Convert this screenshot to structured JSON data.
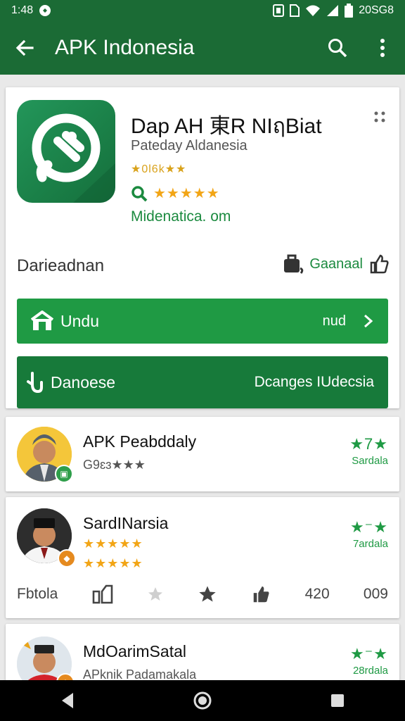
{
  "status_bar": {
    "time": "1:48",
    "right_text": "20SG8",
    "icons": [
      "circle-notification-icon",
      "nfc-icon",
      "sim-icon",
      "wifi-icon",
      "signal-icon",
      "battery-icon"
    ]
  },
  "app_bar": {
    "title": "APK Indonesia",
    "background": "#1b6b35",
    "icons": [
      "back-arrow-icon",
      "search-icon",
      "more-vert-icon"
    ]
  },
  "app": {
    "name": "Dap AH 東R NIฤBiat",
    "developer": "Pateday Aldanesia",
    "rating_small": "★0l6k★★",
    "rating_stars": "★★★★★",
    "link": "Midenatica. om"
  },
  "description": {
    "label": "Darieadnan",
    "right_label": "Gaanaal"
  },
  "primary_button": {
    "label": "Undu",
    "meta": "nud",
    "color": "#1f9a44"
  },
  "secondary_button": {
    "label": "Danoese",
    "meta": "Dcanges IUdecsia",
    "color": "#177a3a"
  },
  "reviews": [
    {
      "name": "APK Peabddaly",
      "sub": "G9ɛɜ★★★",
      "stars": "★7★",
      "count": "Sardala"
    },
    {
      "name": "SardINarsia",
      "sub_stars_1": "★★★★★",
      "sub_stars_2": "★★★★★",
      "stars": "★⁻★",
      "count": "7ardala",
      "actions": {
        "label": "Fbtola",
        "count_1": "420",
        "count_2": "009"
      }
    },
    {
      "name": "MdOarimSatal",
      "sub": "APknik Padamakala",
      "stars": "★⁻★",
      "count": "28rdala"
    }
  ],
  "nav_bar": {
    "icons": [
      "back-triangle-icon",
      "home-circle-icon",
      "recents-square-icon"
    ]
  }
}
